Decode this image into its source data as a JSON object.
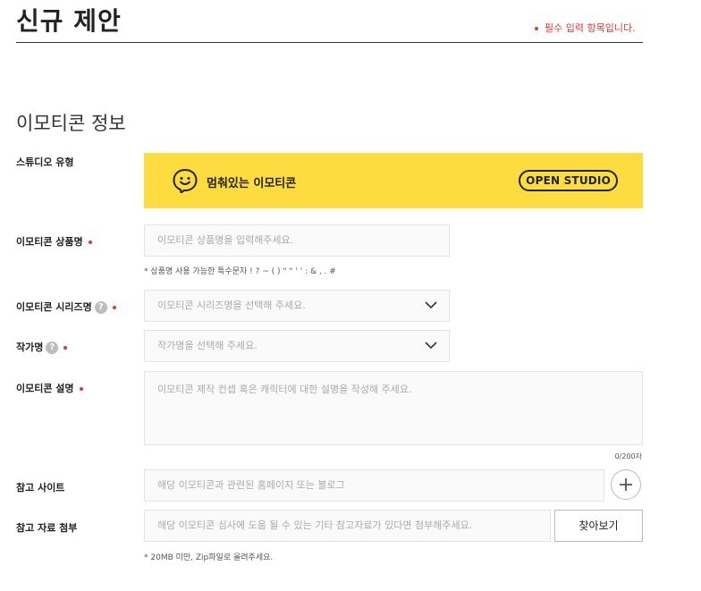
{
  "header": {
    "title": "신규 제안",
    "required_note": "필수 입력 항목입니다."
  },
  "section": {
    "title": "이모티콘 정보"
  },
  "studio": {
    "label": "스튜디오 유형",
    "name": "멈춰있는 이모티콘",
    "badge": "OPEN STUDIO",
    "color": "#fddc3f"
  },
  "product_name": {
    "label": "이모티콘 상품명",
    "placeholder": "이모티콘 상품명을 입력해주세요.",
    "hint": "* 상품명 사용 가능한 특수문자 ! ? ~ ( ) \" \" ' ' : & , . #"
  },
  "series_name": {
    "label": "이모티콘 시리즈명",
    "placeholder": "이모티콘 시리즈명을 선택해 주세요."
  },
  "artist": {
    "label": "작가명",
    "placeholder": "작가명을 선택해 주세요."
  },
  "description": {
    "label": "이모티콘 설명",
    "placeholder": "이모티콘 제작 컨셉 혹은 캐릭터에 대한 설명을 작성해 주세요.",
    "counter": "0/200자"
  },
  "reference_site": {
    "label": "참고 사이트",
    "placeholder": "해당 이모티콘과 관련된 홈페이지 또는 블로그"
  },
  "attachment": {
    "label": "참고 자료 첨부",
    "placeholder": "해당 이모티콘 심사에 도움 될 수 있는 기타 참고자료가 있다면 첨부해주세요.",
    "button": "찾아보기",
    "hint": "* 20MB 미만, Zip파일로 올려주세요."
  },
  "help_glyph": "?",
  "colors": {
    "required": "#e53935",
    "accent": "#fddc3f"
  }
}
